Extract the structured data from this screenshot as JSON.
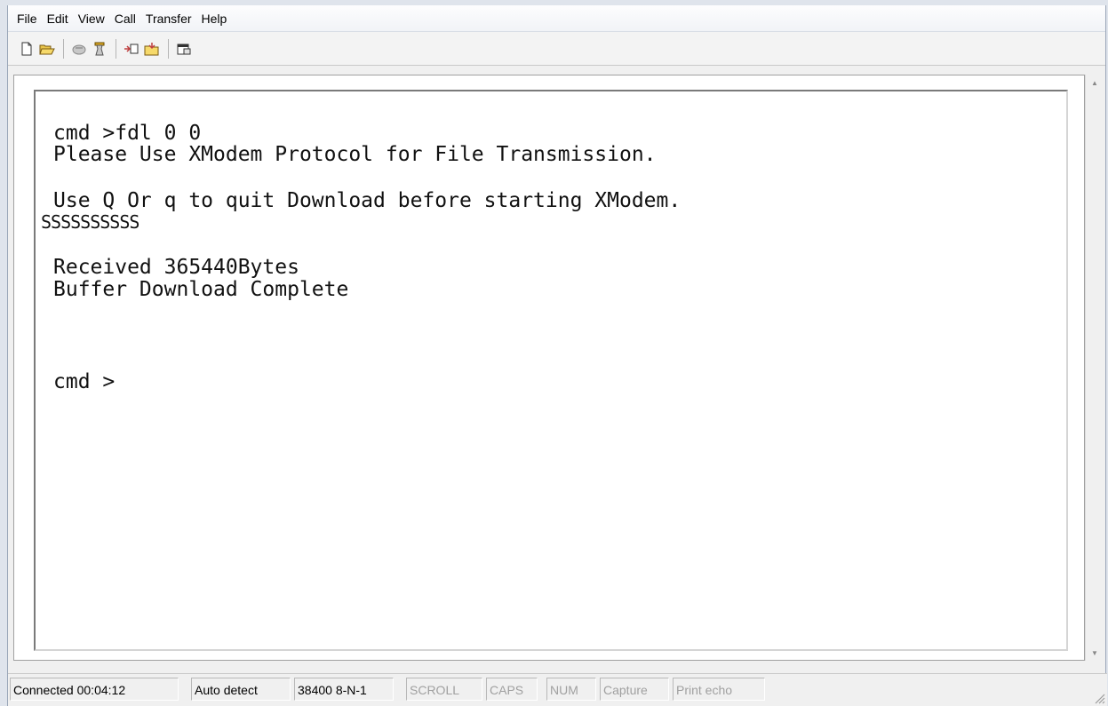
{
  "menu": [
    "File",
    "Edit",
    "View",
    "Call",
    "Transfer",
    "Help"
  ],
  "toolbar": {
    "icons": [
      "new-icon",
      "open-icon",
      "disconnect-icon",
      "dial-icon",
      "send-icon",
      "receive-icon",
      "properties-icon"
    ]
  },
  "terminal": {
    "lines": [
      "cmd >fdl 0 0",
      "Please Use XModem Protocol for File Transmission.",
      "",
      "Use Q Or q to quit Download before starting XModem.",
      "SSSSSSSSSS",
      "",
      "Received 365440Bytes",
      "Buffer Download Complete",
      "",
      "",
      "",
      "cmd >"
    ]
  },
  "status": {
    "connected": "Connected 00:04:12",
    "detect": "Auto detect",
    "port": "38400 8-N-1",
    "scroll": "SCROLL",
    "caps": "CAPS",
    "num": "NUM",
    "capture": "Capture",
    "print_echo": "Print echo"
  }
}
